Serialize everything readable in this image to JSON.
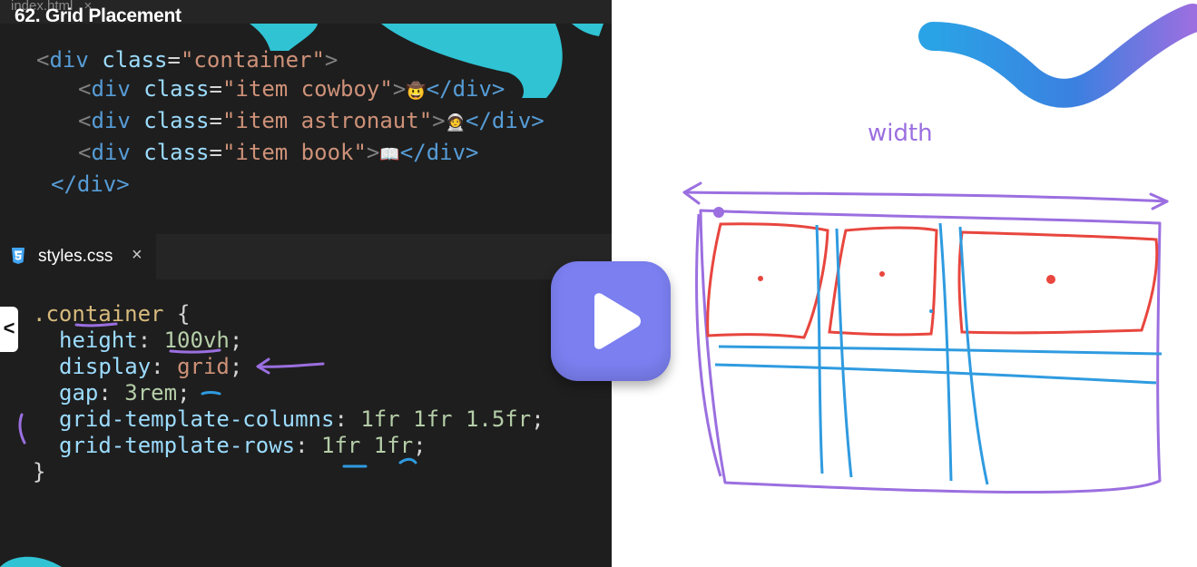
{
  "video": {
    "title": "62. Grid Placement"
  },
  "editor": {
    "top_tab": {
      "label": "index.html",
      "close": "×"
    },
    "html_lines": [
      {
        "open": "<",
        "tag": "div",
        "attr": " class",
        "eq": "=",
        "str": "\"container\"",
        "close": ">",
        "emoji": "",
        "end": ""
      },
      {
        "open": "<",
        "tag": "div",
        "attr": " class",
        "eq": "=",
        "str": "\"item cowboy\"",
        "close": ">",
        "emoji": "🤠",
        "end": "</div>"
      },
      {
        "open": "<",
        "tag": "div",
        "attr": " class",
        "eq": "=",
        "str": "\"item astronaut\"",
        "close": ">",
        "emoji": "🧑‍🚀",
        "end": "</div>"
      },
      {
        "open": "<",
        "tag": "div",
        "attr": " class",
        "eq": "=",
        "str": "\"item book\"",
        "close": ">",
        "emoji": "📖",
        "end": "</div>"
      },
      {
        "end_line": "</div>"
      }
    ],
    "css_tab": {
      "label": "styles.css",
      "close": "×"
    },
    "css": {
      "selector": ".container",
      "brace_open": " {",
      "brace_close": "}",
      "height_prop": "height",
      "height_val": "100vh",
      "display_prop": "display",
      "display_val": "grid",
      "gap_prop": "gap",
      "gap_val": "3rem",
      "cols_prop": "grid-template-columns",
      "cols_val": "1fr 1fr 1.5fr",
      "rows_prop": "grid-template-rows",
      "rows_val": "1fr 1fr"
    },
    "side_arrow": "<"
  },
  "whiteboard": {
    "label": "width"
  },
  "colors": {
    "purple": "#9b6fe0",
    "red": "#e8463e",
    "blue": "#2f9be0",
    "teal": "#33c6d6",
    "play": "#7b7ff0"
  },
  "icons": {
    "play": "play-icon",
    "css_file": "css3-icon",
    "close": "close-icon",
    "arrow": "chevron-left-icon"
  }
}
